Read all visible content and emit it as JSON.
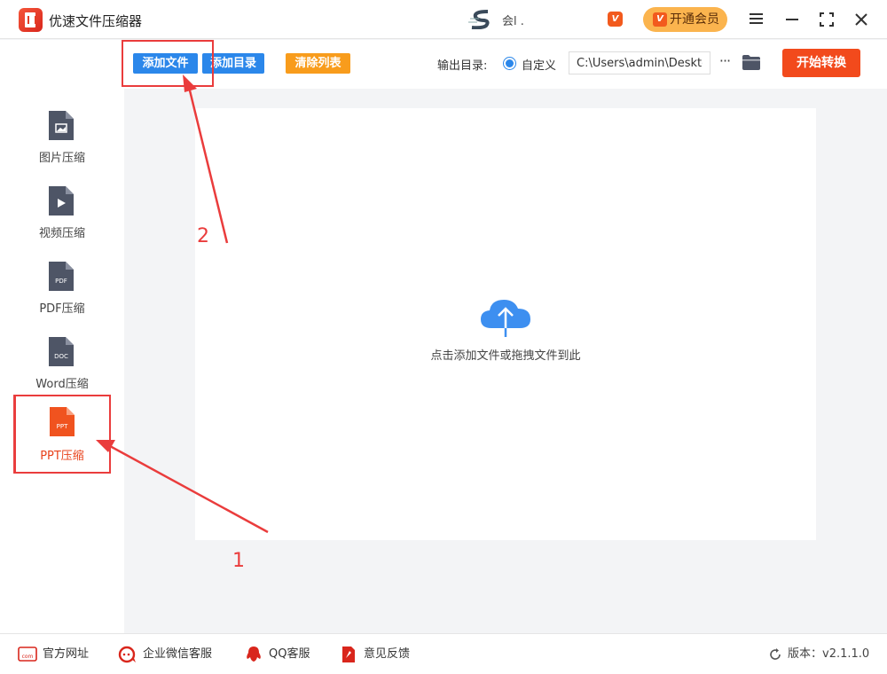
{
  "window": {
    "title": "优速文件压缩器",
    "user_name": "会l .",
    "vip_badge": "V",
    "vip_button_label": "开通会员"
  },
  "toolbar": {
    "add_file": "添加文件",
    "add_dir": "添加目录",
    "clear_list": "清除列表",
    "output_label": "输出目录:",
    "custom_label": "自定义",
    "output_path": "C:\\Users\\admin\\Deskto",
    "more": "···",
    "start": "开始转换"
  },
  "sidebar": {
    "items": [
      {
        "label": "图片压缩",
        "badge": ""
      },
      {
        "label": "视频压缩",
        "badge": ""
      },
      {
        "label": "PDF压缩",
        "badge": "PDF"
      },
      {
        "label": "Word压缩",
        "badge": "DOC"
      },
      {
        "label": "PPT压缩",
        "badge": "PPT"
      }
    ]
  },
  "main": {
    "drop_text": "点击添加文件或拖拽文件到此"
  },
  "footer": {
    "website": "官方网址",
    "website_icon_text": "com",
    "wechat": "企业微信客服",
    "qq": "QQ客服",
    "feedback": "意见反馈",
    "version": "版本：v2.1.1.0"
  },
  "annotations": {
    "step1": "1",
    "step2": "2"
  },
  "colors": {
    "accent_blue": "#2b87ea",
    "accent_orange": "#f89c1c",
    "start_red": "#f24a1c",
    "annotation_red": "#ea3c3c",
    "icon_gray": "#4e5566"
  }
}
